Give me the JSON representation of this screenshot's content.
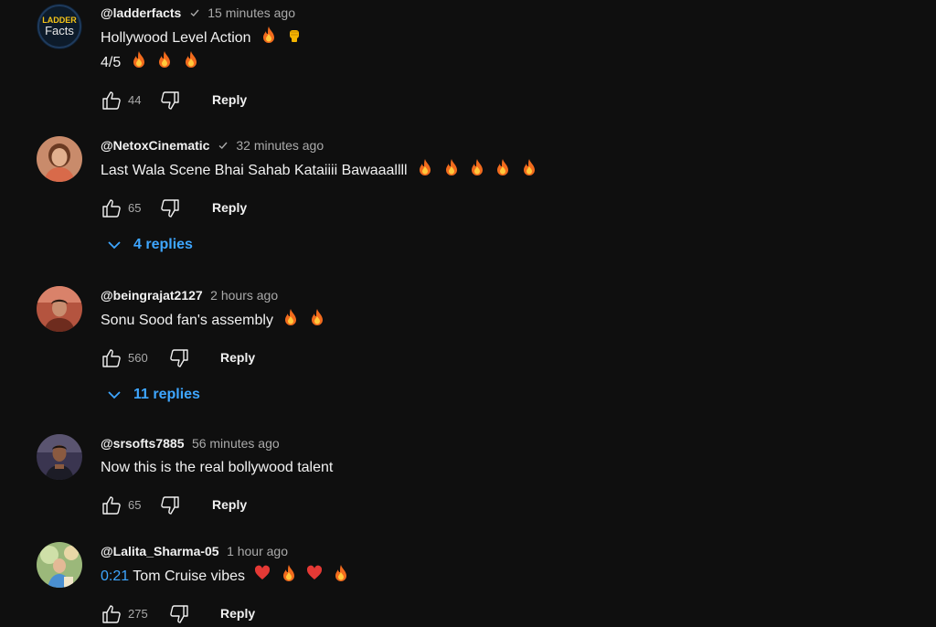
{
  "comments": [
    {
      "handle": "@ladderfacts",
      "verified": true,
      "time": "15 minutes ago",
      "lines": [
        "Hollywood Level Action",
        "4/5"
      ],
      "emojis_line1": [
        "fire",
        "raised-fist"
      ],
      "emojis_line2": [
        "fire",
        "fire",
        "fire"
      ],
      "likes": "44",
      "reply_label": "Reply",
      "avatar_lines": [
        "LADDER",
        "Facts"
      ]
    },
    {
      "handle": "@NetoxCinematic",
      "verified": true,
      "time": "32 minutes ago",
      "lines": [
        "Last Wala Scene Bhai Sahab Kataiiii Bawaaallll"
      ],
      "emojis_line1": [
        "fire",
        "fire",
        "fire",
        "fire",
        "fire"
      ],
      "likes": "65",
      "reply_label": "Reply",
      "replies_label": "4 replies"
    },
    {
      "handle": "@beingrajat2127",
      "verified": false,
      "time": "2 hours ago",
      "lines": [
        "Sonu Sood fan's assembly"
      ],
      "emojis_line1": [
        "fire",
        "fire"
      ],
      "likes": "560",
      "reply_label": "Reply",
      "replies_label": "11 replies"
    },
    {
      "handle": "@srsofts7885",
      "verified": false,
      "time": "56 minutes ago",
      "lines": [
        "Now this is the real bollywood talent"
      ],
      "likes": "65",
      "reply_label": "Reply"
    },
    {
      "handle": "@Lalita_Sharma-05",
      "verified": false,
      "time": "1 hour ago",
      "timestamp_link": "0:21",
      "lines": [
        "Tom Cruise vibes"
      ],
      "emojis_line1": [
        "heart",
        "fire",
        "heart",
        "fire"
      ],
      "likes": "275",
      "reply_label": "Reply"
    }
  ],
  "colors": {
    "background": "#0f0f0f",
    "text": "#f1f1f1",
    "secondary": "#aaaaaa",
    "link": "#3ea6ff"
  }
}
